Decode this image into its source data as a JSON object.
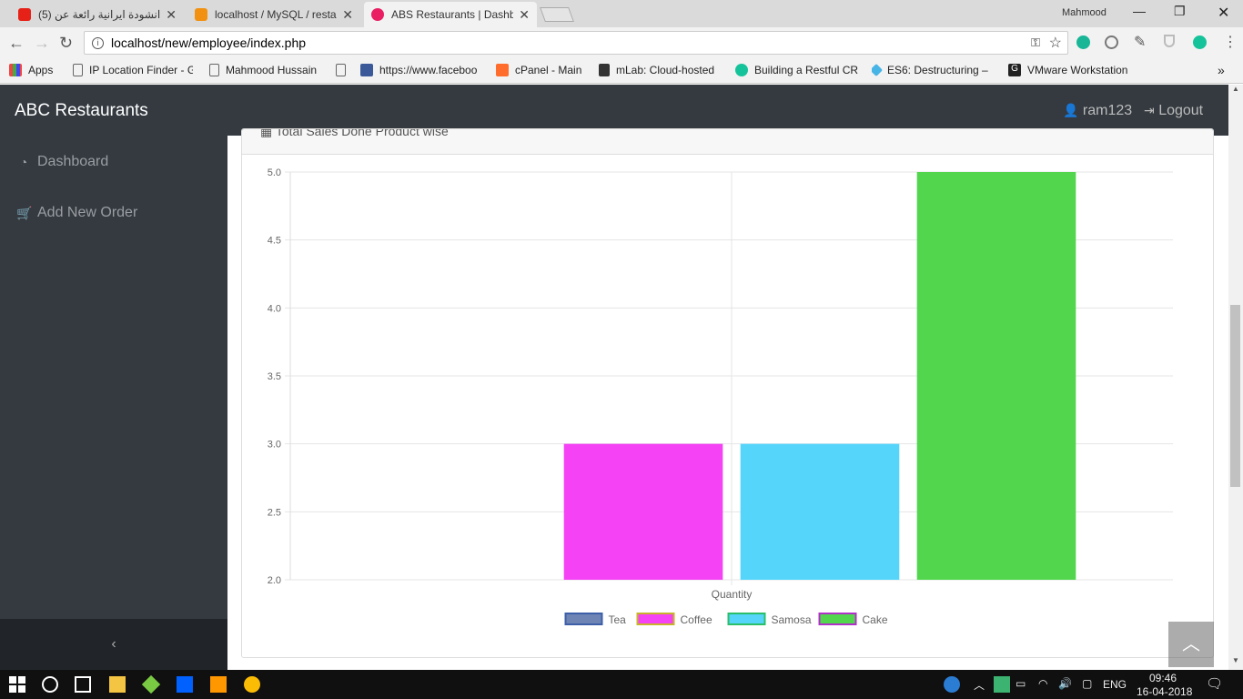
{
  "browser": {
    "tabs": [
      {
        "title": "(5) انشودة ايرانية رائعة عن",
        "color": "#e62117"
      },
      {
        "title": "localhost / MySQL / resta",
        "color": "#f29111"
      },
      {
        "title": "ABS Restaurants | Dashbo",
        "color": "#e91e63"
      }
    ],
    "profile": "Mahmood",
    "address": "localhost/new/employee/index.php",
    "bookmarks": [
      "Apps",
      "IP Location Finder - G",
      "Mahmood Hussain",
      "https://www.faceboo",
      "cPanel - Main",
      "mLab: Cloud-hosted",
      "Building a Restful CR",
      "ES6: Destructuring –",
      "VMware Workstation"
    ]
  },
  "app": {
    "brand": "ABC Restaurants",
    "user": "ram123",
    "logout": "Logout",
    "nav": [
      "Dashboard",
      "Add New Order"
    ],
    "card_title": "Total Sales Done Product wise"
  },
  "chart_data": {
    "type": "bar",
    "categories": [
      "Quantity"
    ],
    "xlabel": "Quantity",
    "ylim": [
      2.0,
      5.0
    ],
    "yticks": [
      "5.0",
      "4.5",
      "4.0",
      "3.5",
      "3.0",
      "2.5",
      "2.0"
    ],
    "legend_position": "bottom",
    "grid": true,
    "series": [
      {
        "name": "Tea",
        "values": [
          2
        ],
        "color": "#6e84b4",
        "border": "#3d5fa8"
      },
      {
        "name": "Coffee",
        "values": [
          3
        ],
        "color": "#f442f4",
        "border": "#c8b42c"
      },
      {
        "name": "Samosa",
        "values": [
          3
        ],
        "color": "#56d5fa",
        "border": "#2bbf6a"
      },
      {
        "name": "Cake",
        "values": [
          5
        ],
        "color": "#52d64e",
        "border": "#b030c8"
      }
    ]
  },
  "taskbar": {
    "lang": "ENG",
    "time": "09:46",
    "date": "16-04-2018"
  }
}
